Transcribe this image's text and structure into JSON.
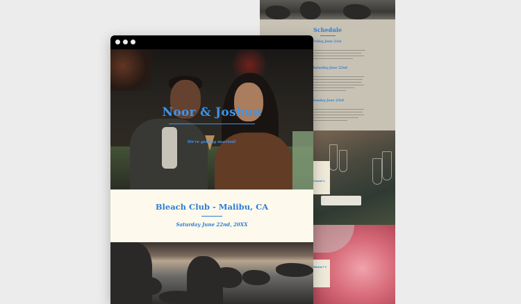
{
  "front_window": {
    "names": "Noor & Joshua",
    "tagline": "We're getting married!",
    "venue": "Bleach Club - Malibu, CA",
    "date": "Saturday June 22nd, 20XX"
  },
  "back_window": {
    "schedule_title": "Schedule",
    "days": [
      "Friday June 21st",
      "Saturday June 22nd",
      "Sunday June 23rd"
    ],
    "cards": [
      "Guest's",
      "Water? I"
    ]
  }
}
